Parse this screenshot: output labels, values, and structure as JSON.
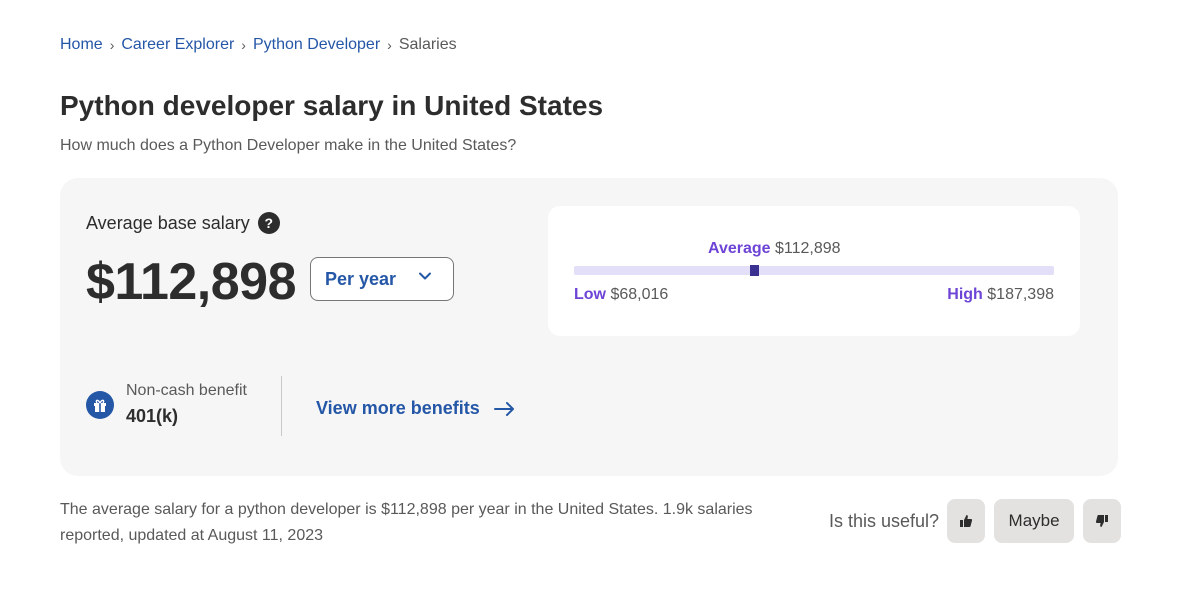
{
  "breadcrumb": {
    "items": [
      "Home",
      "Career Explorer",
      "Python Developer"
    ],
    "current": "Salaries",
    "separator": "›"
  },
  "header": {
    "title": "Python developer salary in United States",
    "subtitle": "How much does a Python Developer make in the United States?"
  },
  "salary": {
    "label": "Average base salary",
    "help_icon": "?",
    "amount": "$112,898",
    "period": {
      "selected": "Per year",
      "icon": "chevron-down-icon"
    }
  },
  "range": {
    "average_label": "Average",
    "average_value": "$112,898",
    "low_label": "Low",
    "low_value": "$68,016",
    "high_label": "High",
    "high_value": "$187,398",
    "marker_fraction": 0.375,
    "colors": {
      "label": "#6e44d6",
      "track": "#e4dff8",
      "marker": "#3b3190"
    }
  },
  "benefit": {
    "title": "Non-cash benefit",
    "value": "401(k)",
    "icon": "gift-icon"
  },
  "view_more": {
    "label": "View more benefits",
    "icon": "arrow-right-icon"
  },
  "footnote": "The average salary for a python developer is $112,898 per year in the United States.  1.9k salaries reported, updated at August 11, 2023",
  "feedback": {
    "question": "Is this useful?",
    "maybe_label": "Maybe",
    "thumbs_up_icon": "thumbs-up-icon",
    "thumbs_down_icon": "thumbs-down-icon"
  },
  "colors": {
    "link": "#2557a7",
    "text": "#2d2d2d",
    "muted": "#595959",
    "card_bg": "#f6f6f6"
  }
}
